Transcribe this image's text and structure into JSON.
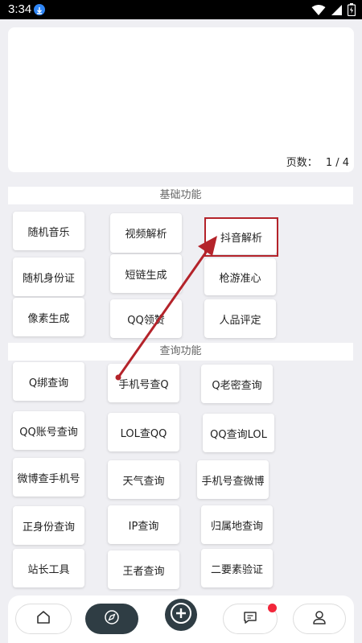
{
  "status_bar": {
    "time": "3:34"
  },
  "banner": {
    "page_label": "页数：",
    "page_value": "1 / 4"
  },
  "sections": {
    "basic": {
      "title": "基础功能",
      "items": [
        "随机音乐",
        "视频解析",
        "抖音解析",
        "随机身份证",
        "短链生成",
        "枪游准心",
        "像素生成",
        "QQ领赞",
        "人品评定"
      ]
    },
    "query": {
      "title": "查询功能",
      "items": [
        "Q绑查询",
        "手机号查Q",
        "Q老密查询",
        "QQ账号查询",
        "LOL查QQ",
        "QQ查询LOL",
        "微博查手机号",
        "天气查询",
        "手机号查微博",
        "正身份查询",
        "IP查询",
        "归属地查询",
        "站长工具",
        "王者查询",
        "二要素验证"
      ]
    }
  },
  "colors": {
    "accent_dark": "#2f3d44",
    "highlight": "#b4232a",
    "badge": "#f2263a"
  },
  "icons": {
    "tab_home": "home-icon",
    "tab_compass": "compass-icon",
    "tab_add": "plus-icon",
    "tab_messages": "message-icon",
    "tab_profile": "user-icon"
  }
}
